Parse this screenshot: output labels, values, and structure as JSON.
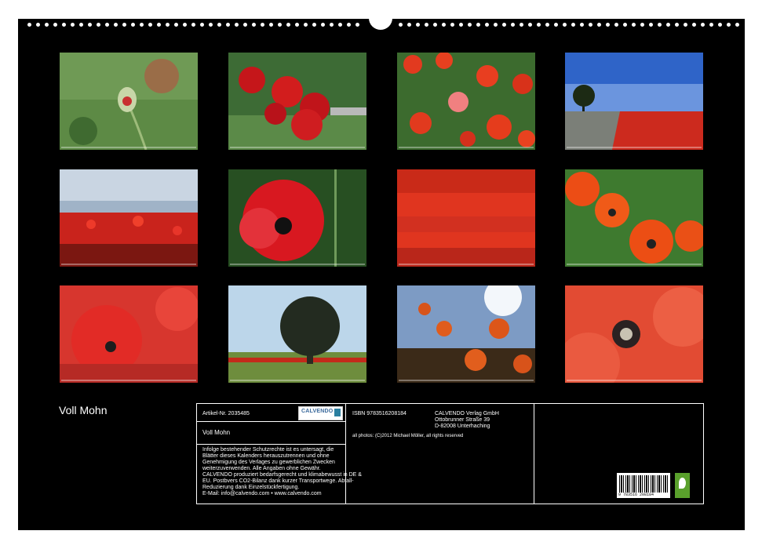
{
  "calendar_title": "Voll Mohn",
  "info": {
    "article_label": "Artikel-Nr. 2035485",
    "logo_text": "CALVENDO",
    "product_name": "Voll Mohn",
    "legal_text": [
      "Infolge bestehender Schutzrechte ist es untersagt, die",
      "Blätter dieses Kalenders herauszutrennen und ohne",
      "Genehmigung des Verlages zu gewerblichen Zwecken",
      "weiterzuverwenden. Alle Angaben ohne Gewähr.",
      "CALVENDO produziert bedarfsgerecht und klimabewusst in DE &",
      "EU. Postbvers CO2-Bilanz dank kurzer Transportwege. Abfall-",
      "Reduzierung dank Einzelstückfertigung.",
      "E-Mail: info@calvendo.com • www.calvendo.com"
    ],
    "isbn": "ISBN 9783516208184",
    "publisher_lines": [
      "CALVENDO Verlag GmbH",
      "Ottobrunner Straße 39",
      "D-82008 Unterhaching"
    ],
    "photo_credit": "all photos: (C)2012 Michael Möller, all rights reserved",
    "barcode_number": "9 783516 208184"
  },
  "photos": [
    {
      "subject": "poppy bud on green background"
    },
    {
      "subject": "red poppies in front of hedge"
    },
    {
      "subject": "field of red poppies"
    },
    {
      "subject": "lone tree and poppy field under blue sky"
    },
    {
      "subject": "poppy meadow under cloudy sky"
    },
    {
      "subject": "single large red poppy"
    },
    {
      "subject": "dense poppy field"
    },
    {
      "subject": "orange poppies close-up"
    },
    {
      "subject": "poppy blossoms close-up"
    },
    {
      "subject": "large tree in field with poppies"
    },
    {
      "subject": "poppies against sunny sky"
    },
    {
      "subject": "macro of poppy center"
    }
  ]
}
